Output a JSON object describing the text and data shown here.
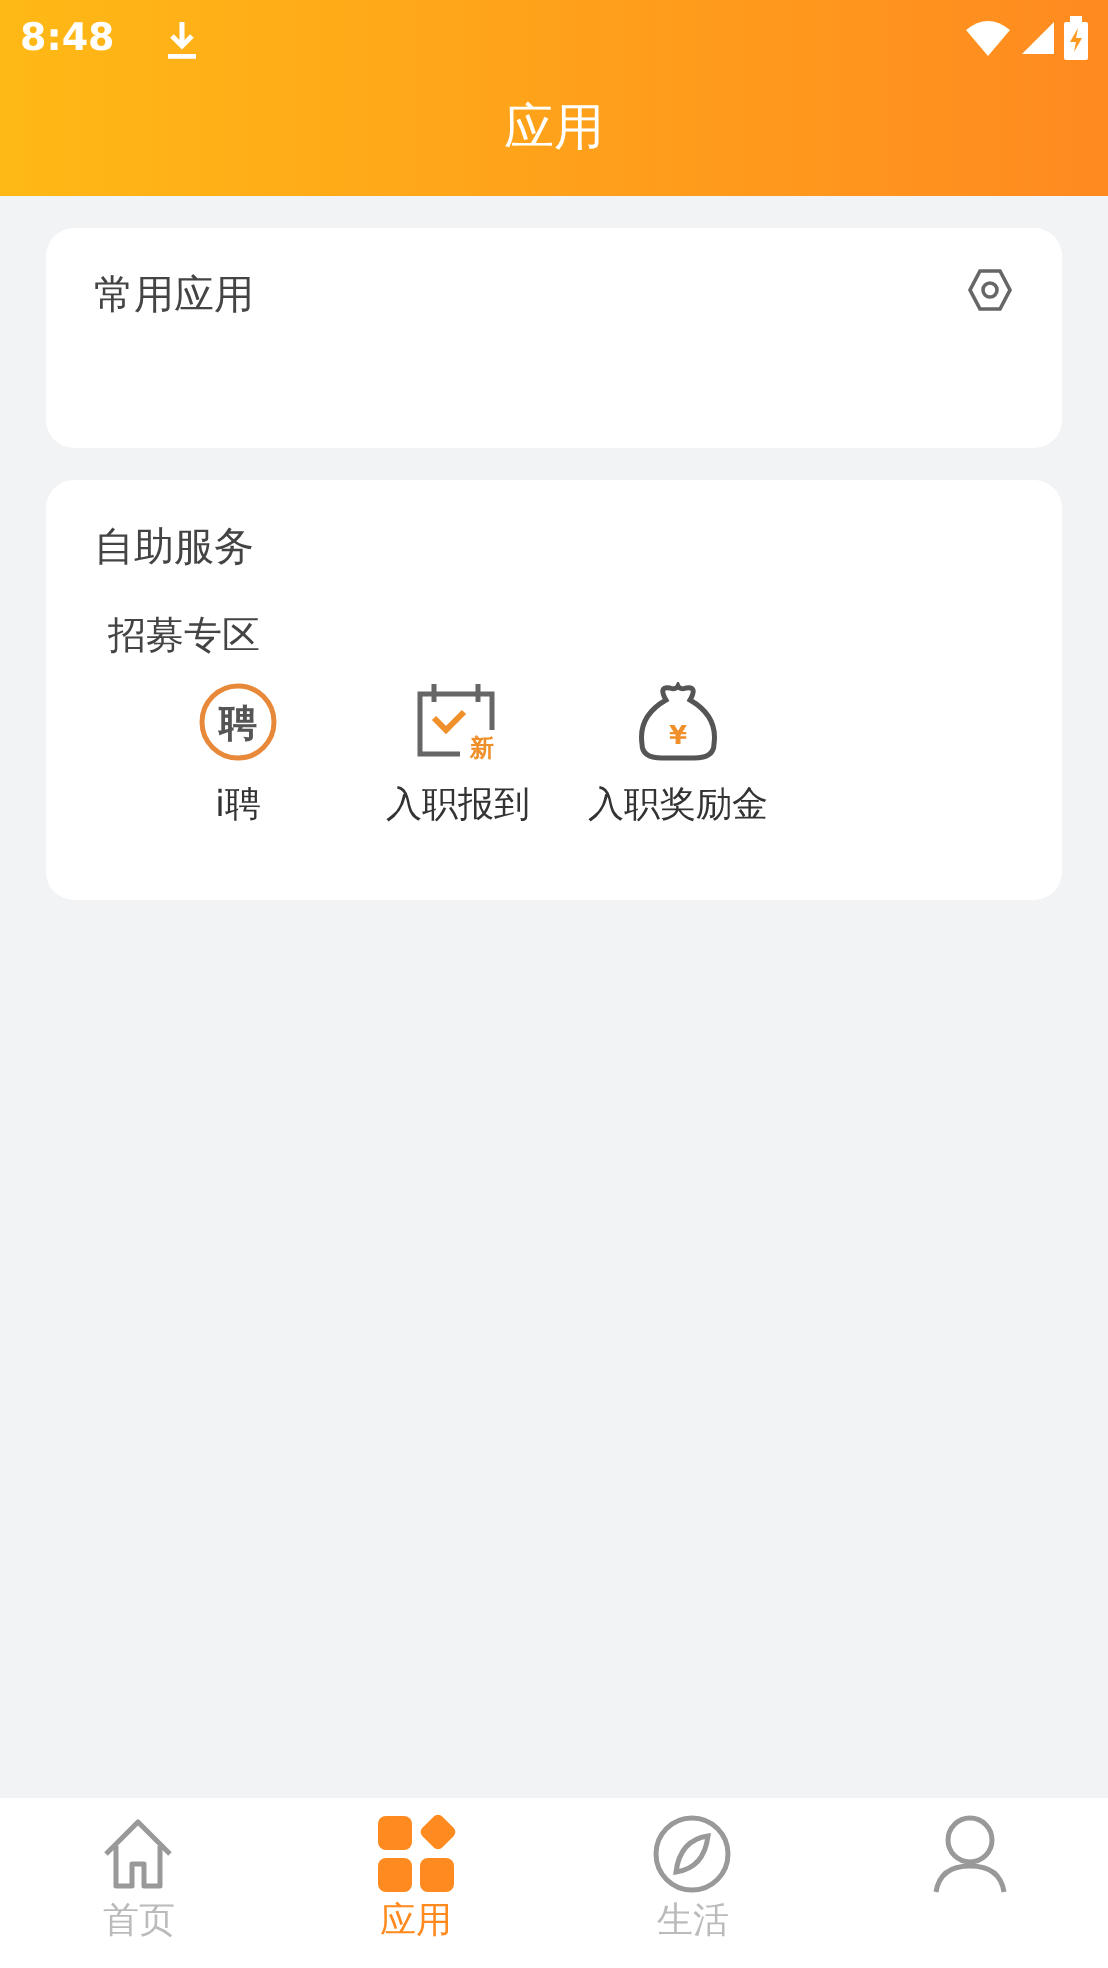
{
  "status_bar": {
    "time": "8:48"
  },
  "header": {
    "title": "应用"
  },
  "sections": [
    {
      "title": "常用应用"
    },
    {
      "title": "自助服务",
      "groups": [
        {
          "title": "招募专区",
          "apps": [
            {
              "label": "i聘",
              "kind": "hire",
              "icon_text": "聘"
            },
            {
              "label": "入职报到",
              "kind": "checkin",
              "icon_text": "新"
            },
            {
              "label": "入职奖励金",
              "kind": "bonus",
              "icon_text": "¥"
            }
          ]
        }
      ]
    }
  ],
  "tabs": [
    {
      "label": "首页",
      "kind": "home",
      "selected": false
    },
    {
      "label": "应用",
      "kind": "apps",
      "selected": true
    },
    {
      "label": "生活",
      "kind": "life",
      "selected": false
    },
    {
      "kind": "me",
      "selected": false
    }
  ]
}
